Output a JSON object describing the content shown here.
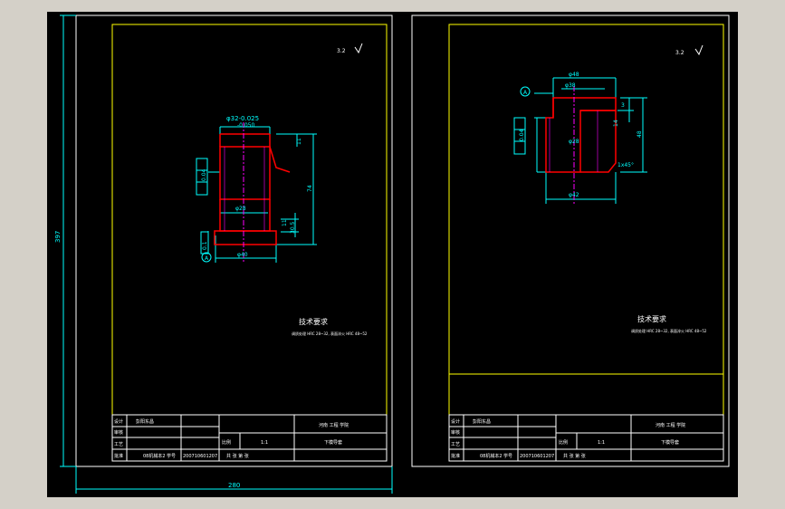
{
  "colors": {
    "background_outer": "#d4d0c8",
    "canvas": "#000000",
    "frame": "#ffffff",
    "border": "#ffff00",
    "dimension": "#00ffff",
    "part": "#ff0000",
    "center": "#ff00ff",
    "text_white": "#ffffff",
    "text_yellow": "#ffff00"
  },
  "left_sheet": {
    "dim_overall_height": "397",
    "dim_overall_width": "280",
    "roughness_mark": "3.2",
    "part": {
      "dim_top_dia": "φ32-0.025",
      "dim_top_dia2": "-0.050",
      "dim_bottom_dia": "φ40",
      "dim_inner_dia": "φ28",
      "dim_right_height": "74",
      "dim_right_top": "11",
      "dim_right_bottom": "11",
      "dim_step": "30.5",
      "tolerance_box": "0.04",
      "datum_label": "A",
      "tol_left": "0.1"
    },
    "tech_title": "技术要求",
    "tech_note": "调质处理 HRC 28~32, 表面淬火 HRC 48~52",
    "title_block": {
      "row1_label": "设计",
      "row1_value": "彭阳东昌",
      "row2_label": "审核",
      "row3_label": "工艺",
      "row4_label": "批准",
      "row4_value": "08机械本2",
      "student_label": "学号",
      "student_value": "200710601207",
      "scale_label": "比例",
      "scale_value": "1:1",
      "material_label": "材料",
      "sheet_label": "共 张 第 张",
      "school": "河南 工程 学院",
      "dwg_name": "下模导套"
    }
  },
  "right_sheet": {
    "roughness_mark": "3.2",
    "part": {
      "dim_top_outer": "φ48",
      "dim_top_inner": "φ38",
      "dim_inner_dia": "φ28",
      "dim_bottom_dia": "φ42",
      "dim_right_height": "48",
      "dim_step_a": "3",
      "dim_step_b": "14",
      "chamfer": "1x45°",
      "datum_label": "A",
      "tolerance_box": "0.04"
    },
    "tech_title": "技术要求",
    "tech_note": "调质处理 HRC 28~32, 表面淬火 HRC 48~52",
    "title_block": {
      "row1_label": "设计",
      "row1_value": "彭阳东昌",
      "row2_label": "审核",
      "row3_label": "工艺",
      "row4_label": "批准",
      "row4_value": "08机械本2",
      "student_label": "学号",
      "student_value": "200710601207",
      "scale_label": "比例",
      "scale_value": "1:1",
      "material_label": "材料",
      "sheet_label": "共 张 第 张",
      "school": "河南 工程 学院",
      "dwg_name": "下模导套"
    }
  }
}
